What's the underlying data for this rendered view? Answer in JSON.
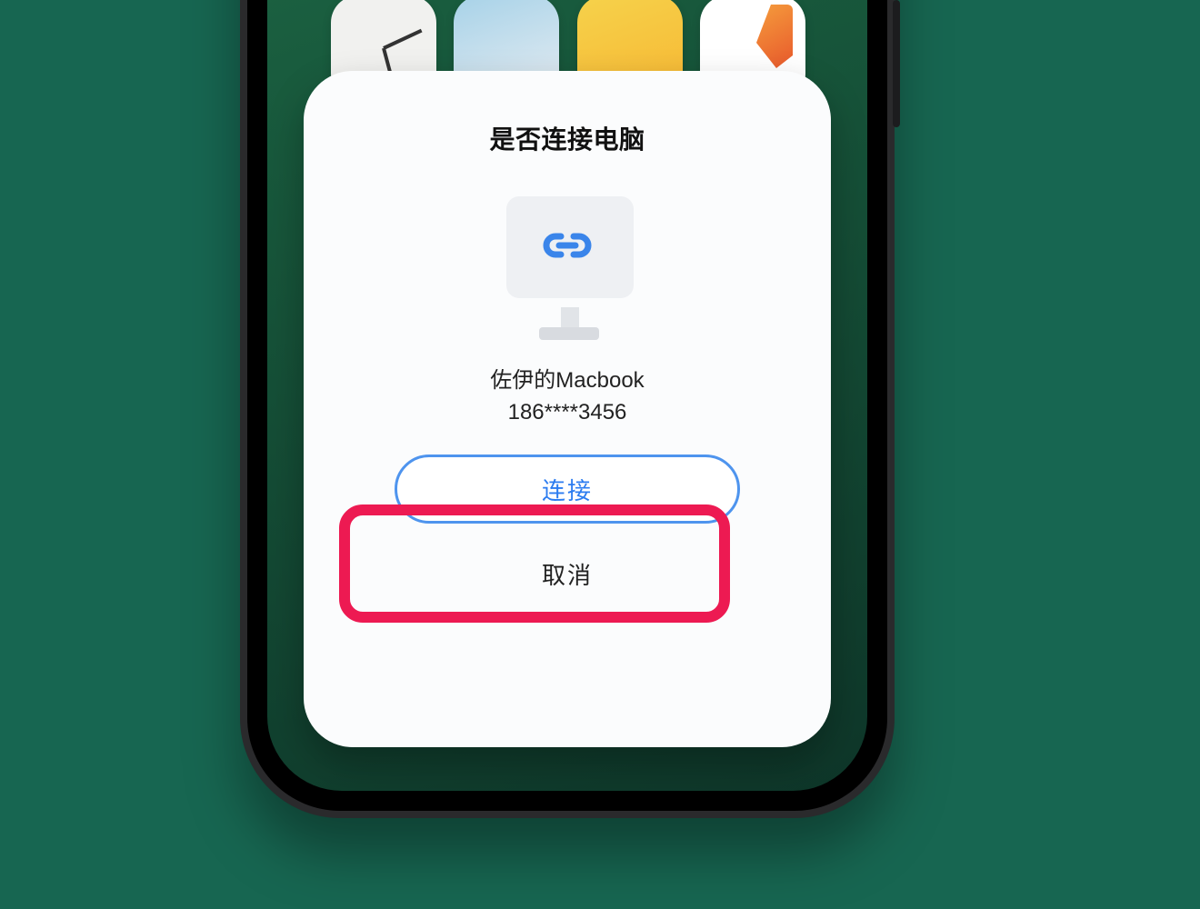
{
  "dialog": {
    "title": "是否连接电脑",
    "device_name": "佐伊的Macbook",
    "device_sub": "186****3456",
    "connect_label": "连接",
    "cancel_label": "取消"
  },
  "icons": {
    "link": "link-icon",
    "clock": "clock-icon",
    "weather": "weather-icon",
    "files": "files-icon",
    "notes": "notes-icon"
  },
  "colors": {
    "accent": "#2c7cf0",
    "accent_border": "#4e94ee",
    "highlight": "#ed1a52"
  }
}
